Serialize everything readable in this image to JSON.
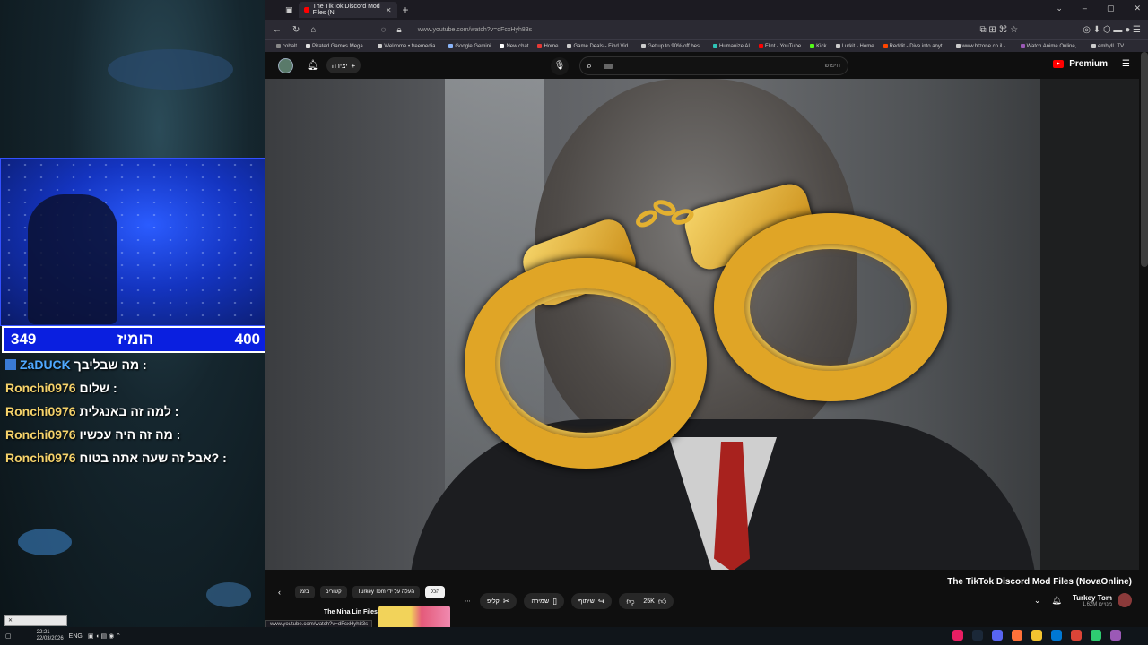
{
  "stream": {
    "vote_left": "349",
    "vote_title": "הומיז",
    "vote_right": "400",
    "chat": [
      {
        "user": "ZaDUCK",
        "message": "מה שבליבך :",
        "badge": true
      },
      {
        "user": "Ronchi0976",
        "message": "שלום :",
        "badge": false
      },
      {
        "user": "Ronchi0976",
        "message": "למה זה באנגלית :",
        "badge": false
      },
      {
        "user": "Ronchi0976",
        "message": "מה זה היה עכשיו :",
        "badge": false
      },
      {
        "user": "Ronchi0976",
        "message": "אבל זה שעה אתה בטוח? :",
        "badge": false
      }
    ],
    "clock_time": "22:21",
    "clock_date": "22/03/2026",
    "lang": "ENG"
  },
  "browser": {
    "tab_title": "The TikTok Discord Mod Files (N",
    "url": "www.youtube.com/watch?v=dFcxHyh83s",
    "bookmarks": [
      {
        "label": "cobalt",
        "color": "#888888"
      },
      {
        "label": "Pirated Games Mega ...",
        "color": "#e0e0e0"
      },
      {
        "label": "Welcome • freemedia...",
        "color": "#cccccc"
      },
      {
        "label": "Google Gemini",
        "color": "#8ab4f8"
      },
      {
        "label": "New chat",
        "color": "#ffffff"
      },
      {
        "label": "Home",
        "color": "#e53935"
      },
      {
        "label": "Game Deals - Find Vid...",
        "color": "#cccccc"
      },
      {
        "label": "Get up to 90% off bes...",
        "color": "#cccccc"
      },
      {
        "label": "Humanize AI",
        "color": "#2ec4b6"
      },
      {
        "label": "Flint - YouTube",
        "color": "#ff0000"
      },
      {
        "label": "Kick",
        "color": "#53fc18"
      },
      {
        "label": "Lurkit - Home",
        "color": "#cccccc"
      },
      {
        "label": "Reddit - Dive into anyt...",
        "color": "#ff4500"
      },
      {
        "label": "www.htzone.co.il - ...",
        "color": "#cccccc"
      },
      {
        "label": "Watch Anime Online, ...",
        "color": "#9b59b6"
      },
      {
        "label": "embyIL.TV",
        "color": "#cccccc"
      }
    ]
  },
  "youtube": {
    "create_label": "יצירה",
    "search_placeholder": "חיפוש",
    "premium_label": "Premium",
    "video_title": "The TikTok Discord Mod Files (NovaOnline)",
    "channel_name": "Turkey Tom",
    "channel_subs": "1.62M מנויים",
    "likes": "25K",
    "share_label": "שיתוף",
    "save_label": "שמירה",
    "clip_label": "קליפ",
    "chips": [
      "הכל",
      "Turkey Tom העלה על ידי",
      "קשורים",
      "בזמ"
    ],
    "rec_title": "The Nina Lin Files",
    "status_url": "www.youtube.com/watch?v=dFcxHyh83s"
  }
}
